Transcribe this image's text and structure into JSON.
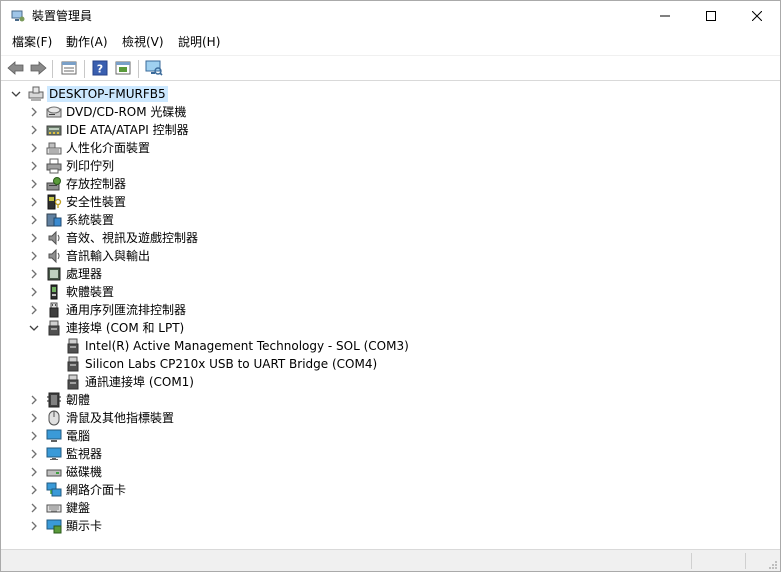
{
  "window": {
    "title": "裝置管理員"
  },
  "menu": [
    "檔案(F)",
    "動作(A)",
    "檢視(V)",
    "說明(H)"
  ],
  "toolbar": {
    "buttons": [
      "back-arrow-icon",
      "forward-arrow-icon",
      "properties-icon",
      "help-icon",
      "update-driver-icon",
      "scan-hardware-icon"
    ]
  },
  "tree": {
    "root": "DESKTOP-FMURFB5",
    "categories": [
      {
        "label": "DVD/CD-ROM 光碟機",
        "icon": "dvd-drive-icon",
        "expanded": false
      },
      {
        "label": "IDE ATA/ATAPI 控制器",
        "icon": "ide-controller-icon",
        "expanded": false
      },
      {
        "label": "人性化介面裝置",
        "icon": "hid-icon",
        "expanded": false
      },
      {
        "label": "列印佇列",
        "icon": "printer-icon",
        "expanded": false
      },
      {
        "label": "存放控制器",
        "icon": "storage-controller-icon",
        "expanded": false
      },
      {
        "label": "安全性裝置",
        "icon": "security-device-icon",
        "expanded": false
      },
      {
        "label": "系統裝置",
        "icon": "system-device-icon",
        "expanded": false
      },
      {
        "label": "音效、視訊及遊戲控制器",
        "icon": "speaker-icon",
        "expanded": false
      },
      {
        "label": "音訊輸入與輸出",
        "icon": "speaker-icon",
        "expanded": false
      },
      {
        "label": "處理器",
        "icon": "processor-icon",
        "expanded": false
      },
      {
        "label": "軟體裝置",
        "icon": "software-device-icon",
        "expanded": false
      },
      {
        "label": "通用序列匯流排控制器",
        "icon": "usb-icon",
        "expanded": false
      },
      {
        "label": "連接埠 (COM 和 LPT)",
        "icon": "port-icon",
        "expanded": true
      },
      {
        "label": "Intel(R) Active Management Technology - SOL (COM3)",
        "icon": "port-icon",
        "child": true
      },
      {
        "label": "Silicon Labs CP210x USB to UART Bridge (COM4)",
        "icon": "port-icon",
        "child": true
      },
      {
        "label": "通訊連接埠 (COM1)",
        "icon": "port-icon",
        "child": true
      },
      {
        "label": "韌體",
        "icon": "firmware-icon",
        "expanded": false
      },
      {
        "label": "滑鼠及其他指標裝置",
        "icon": "mouse-icon",
        "expanded": false
      },
      {
        "label": "電腦",
        "icon": "computer-icon",
        "expanded": false
      },
      {
        "label": "監視器",
        "icon": "monitor-icon",
        "expanded": false
      },
      {
        "label": "磁碟機",
        "icon": "disk-drive-icon",
        "expanded": false
      },
      {
        "label": "網路介面卡",
        "icon": "network-adapter-icon",
        "expanded": false
      },
      {
        "label": "鍵盤",
        "icon": "keyboard-icon",
        "expanded": false
      },
      {
        "label": "顯示卡",
        "icon": "display-adapter-icon",
        "expanded": false
      }
    ]
  },
  "colors": {
    "selection": "#cce8ff",
    "chevron": "#606060",
    "border": "#aaaaaa"
  }
}
